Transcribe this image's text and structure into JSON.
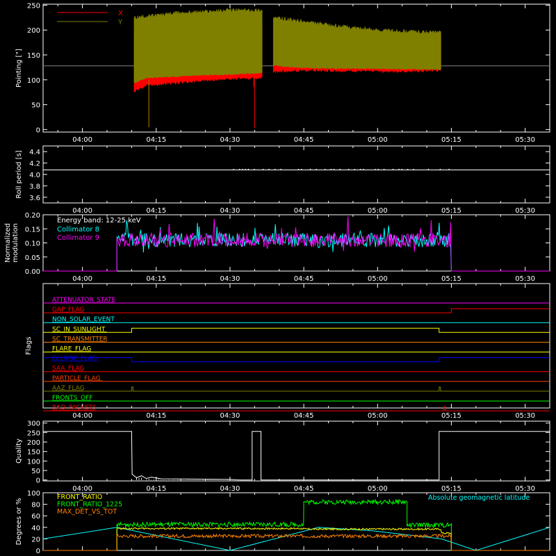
{
  "colors": {
    "background": "#000000",
    "axis": "#ffffff",
    "x_pointing": "#ff0000",
    "y_pointing": "#808000",
    "collimator8": "#00ffff",
    "collimator9": "#ff00ff",
    "front_ratio": "#ffff00",
    "front_ratio_1225": "#00ff00",
    "max_det_vs_tot": "#ff8000",
    "geomag": "#00ffff"
  },
  "time_axis": {
    "start": "03:52",
    "end": "05:35",
    "tick_labels": [
      "04:00",
      "04:15",
      "04:30",
      "04:45",
      "05:00",
      "05:15",
      "05:30"
    ],
    "tick_minutes": [
      240,
      255,
      270,
      285,
      300,
      315,
      330
    ],
    "range_minutes": [
      232,
      335
    ]
  },
  "chart_data": [
    {
      "type": "line",
      "ylabel": "Pointing [\"]",
      "ylim": [
        -5,
        252
      ],
      "yticks": [
        "0",
        "50",
        "100",
        "150",
        "200",
        "250"
      ],
      "yticks_values": [
        0,
        50,
        100,
        150,
        200,
        250
      ],
      "legend": [
        {
          "name": "X",
          "color": "#ff0000"
        },
        {
          "name": "Y",
          "color": "#808000"
        }
      ],
      "reference_y": 128,
      "series": [
        {
          "name": "X",
          "band_low": [
            [
              250.5,
              80
            ],
            [
              253,
              92
            ],
            [
              257,
              95
            ],
            [
              263,
              100
            ],
            [
              270,
              105
            ],
            [
              276.5,
              107
            ],
            [
              279,
              120
            ],
            [
              285,
              122
            ],
            [
              295,
              121
            ],
            [
              305,
              120
            ],
            [
              313,
              122
            ]
          ],
          "band_high": [
            [
              250.5,
              185
            ],
            [
              260,
              200
            ],
            [
              270,
              215
            ],
            [
              276.5,
              215
            ],
            [
              279,
              205
            ],
            [
              290,
              195
            ],
            [
              300,
              190
            ],
            [
              313,
              190
            ]
          ],
          "spikes": [
            [
              253.5,
              5
            ],
            [
              275,
              3
            ],
            [
              274.8,
              85
            ]
          ]
        },
        {
          "name": "Y",
          "band_low": [
            [
              250.5,
              95
            ],
            [
              253,
              105
            ],
            [
              257,
              107
            ],
            [
              263,
              110
            ],
            [
              270,
              112
            ],
            [
              276.5,
              115
            ],
            [
              279,
              130
            ],
            [
              285,
              125
            ],
            [
              295,
              124
            ],
            [
              305,
              123
            ],
            [
              313,
              122
            ]
          ],
          "band_high": [
            [
              250.5,
              225
            ],
            [
              260,
              235
            ],
            [
              270,
              240
            ],
            [
              276.5,
              240
            ],
            [
              279,
              225
            ],
            [
              290,
              210
            ],
            [
              300,
              200
            ],
            [
              313,
              195
            ]
          ]
        }
      ]
    },
    {
      "type": "line",
      "ylabel": "Roll period [s]",
      "ylim": [
        3.5,
        4.5
      ],
      "yticks": [
        "3.6",
        "3.8",
        "4.0",
        "4.2",
        "4.4"
      ],
      "yticks_values": [
        3.6,
        3.8,
        4.0,
        4.2,
        4.4
      ],
      "series": [
        {
          "name": "",
          "value": 4.08,
          "active_range": [
            270,
            315
          ]
        }
      ]
    },
    {
      "type": "line",
      "ylabel": "Normalized modulation",
      "ylim": [
        0,
        0.2
      ],
      "yticks": [
        "0.00",
        "0.05",
        "0.10",
        "0.15",
        "0.20"
      ],
      "yticks_values": [
        0.0,
        0.05,
        0.1,
        0.15,
        0.2
      ],
      "annotation": "Energy band: 12-25 keV",
      "legend": [
        {
          "name": "Collimator 8",
          "color": "#00ffff"
        },
        {
          "name": "Collimator 9",
          "color": "#ff00ff"
        }
      ],
      "series": [
        {
          "name": "Collimator 8",
          "mean": 0.11,
          "range": [
            247,
            315
          ]
        },
        {
          "name": "Collimator 9",
          "mean": 0.11,
          "range": [
            247,
            315
          ]
        }
      ]
    },
    {
      "type": "line",
      "ylabel": "Flags",
      "flags": [
        {
          "name": "ATTENUATOR_STATE",
          "color": "#ff00ff",
          "steps": []
        },
        {
          "name": "GAP_FLAG",
          "color": "#ff0000",
          "steps": [
            [
              315,
              1
            ]
          ]
        },
        {
          "name": "NON_SOLAR_EVENT",
          "color": "#00ffff",
          "steps": []
        },
        {
          "name": "SC_IN_SUNLIGHT",
          "color": "#ffff00",
          "steps": [
            [
              250,
              1
            ],
            [
              312.5,
              0
            ]
          ]
        },
        {
          "name": "SC_TRANSMITTER",
          "color": "#ff8000",
          "steps": []
        },
        {
          "name": "FLARE_FLAG",
          "color": "#ffff00",
          "steps": []
        },
        {
          "name": "ECLIPSE_FLAG",
          "color": "#0000ff",
          "steps": [
            [
              250,
              0
            ],
            [
              312.5,
              1
            ]
          ],
          "initial": 1
        },
        {
          "name": "SAA_FLAG",
          "color": "#ff0000",
          "steps": []
        },
        {
          "name": "PARTICLE_FLAG",
          "color": "#ff4000",
          "steps": []
        },
        {
          "name": "AAZ_FLAG",
          "color": "#808000",
          "pulses": [
            250,
            312.5
          ]
        },
        {
          "name": "FRONTS_OFF",
          "color": "#00ff00",
          "steps": []
        },
        {
          "name": "BAD_PACKETS",
          "color": "#ff0000",
          "pulses": [
            313.5
          ]
        }
      ]
    },
    {
      "type": "line",
      "ylabel": "Quality",
      "ylim": [
        -5,
        310
      ],
      "yticks": [
        "0",
        "50",
        "100",
        "150",
        "200",
        "250",
        "300"
      ],
      "yticks_values": [
        0,
        50,
        100,
        150,
        200,
        250,
        300
      ],
      "series": [
        {
          "name": "",
          "points": [
            [
              232,
              256
            ],
            [
              250,
              256
            ],
            [
              250.1,
              30
            ],
            [
              251,
              12
            ],
            [
              252,
              22
            ],
            [
              253,
              8
            ],
            [
              254,
              15
            ],
            [
              256,
              6
            ],
            [
              270,
              3
            ],
            [
              272,
              0
            ],
            [
              274.5,
              0
            ],
            [
              274.5,
              256
            ],
            [
              276.3,
              256
            ],
            [
              276.3,
              0
            ],
            [
              312.5,
              0
            ],
            [
              312.5,
              256
            ],
            [
              335,
              256
            ]
          ]
        }
      ]
    },
    {
      "type": "line",
      "ylabel": "Degrees or %",
      "ylim": [
        0,
        100
      ],
      "yticks": [
        "0",
        "20",
        "40",
        "60",
        "80",
        "100"
      ],
      "yticks_values": [
        0,
        20,
        40,
        60,
        80,
        100
      ],
      "legend": [
        {
          "name": "FRONT_RATIO",
          "color": "#ffff00"
        },
        {
          "name": "FRONT_RATIO_1225",
          "color": "#00ff00"
        },
        {
          "name": "MAX_DET_VS_TOT",
          "color": "#ff8000"
        }
      ],
      "right_legend": {
        "name": "Absolute geomagnetic latitude",
        "color": "#00ffff"
      },
      "series": [
        {
          "name": "FRONT_RATIO",
          "segments": [
            [
              247,
              285,
              38
            ],
            [
              285,
              313,
              37
            ],
            [
              313,
              315,
              30
            ]
          ]
        },
        {
          "name": "FRONT_RATIO_1225",
          "segments": [
            [
              247,
              285,
              45
            ],
            [
              285,
              306,
              84
            ],
            [
              306,
              315,
              44
            ]
          ]
        },
        {
          "name": "MAX_DET_VS_TOT",
          "segments": [
            [
              247,
              315,
              25
            ]
          ]
        },
        {
          "name": "Absolute geomagnetic latitude",
          "points": [
            [
              232,
              20
            ],
            [
              247,
              40
            ],
            [
              270,
              0
            ],
            [
              288,
              40
            ],
            [
              299,
              34
            ],
            [
              313,
              20
            ],
            [
              320,
              0
            ],
            [
              335,
              40
            ]
          ]
        }
      ]
    }
  ]
}
